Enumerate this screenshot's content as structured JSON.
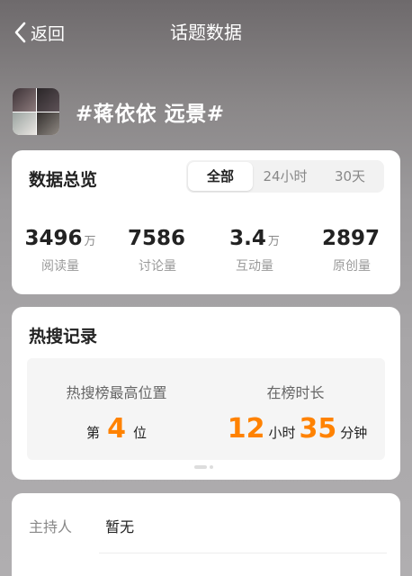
{
  "nav": {
    "back_label": "返回",
    "title": "话题数据"
  },
  "topic": {
    "name": "#蒋依依 远景#"
  },
  "overview": {
    "title": "数据总览",
    "tabs": [
      {
        "label": "全部",
        "active": true
      },
      {
        "label": "24小时",
        "active": false
      },
      {
        "label": "30天",
        "active": false
      }
    ],
    "stats": [
      {
        "value": "3496",
        "unit": "万",
        "label": "阅读量"
      },
      {
        "value": "7586",
        "unit": "",
        "label": "讨论量"
      },
      {
        "value": "3.4",
        "unit": "万",
        "label": "互动量"
      },
      {
        "value": "2897",
        "unit": "",
        "label": "原创量"
      }
    ]
  },
  "hot": {
    "title": "热搜记录",
    "rank_label": "热搜榜最高位置",
    "rank_prefix": "第",
    "rank_value": "4",
    "rank_suffix": "位",
    "duration_label": "在榜时长",
    "hours_value": "12",
    "hours_unit": "小时",
    "minutes_value": "35",
    "minutes_unit": "分钟"
  },
  "info": {
    "host_key": "主持人",
    "host_value": "暂无"
  },
  "colors": {
    "accent": "#ff8200"
  }
}
